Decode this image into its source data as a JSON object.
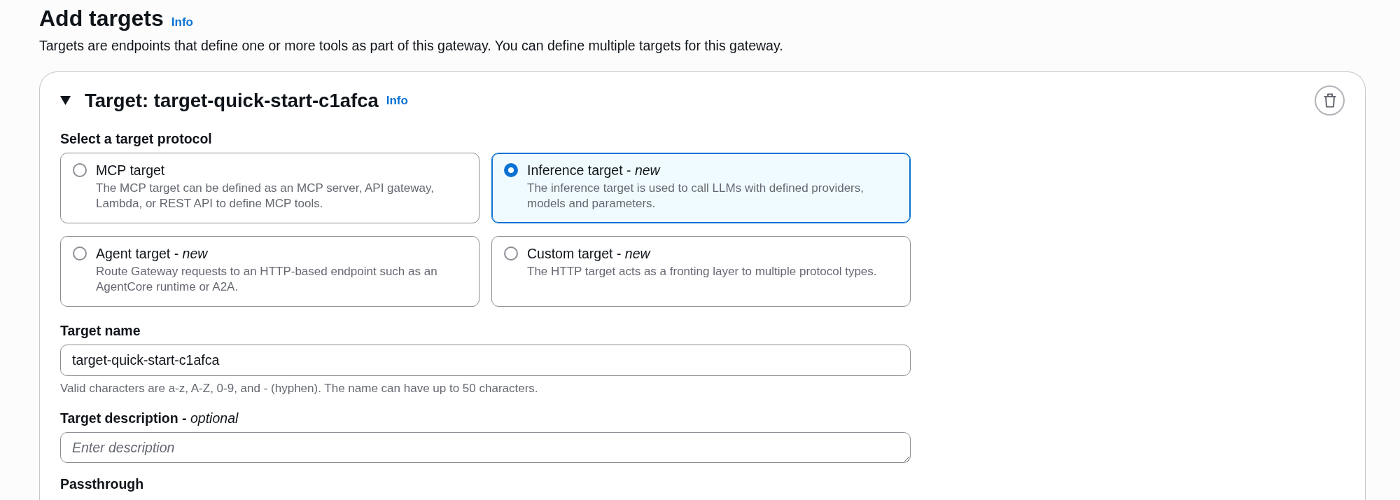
{
  "page": {
    "title": "Add targets",
    "info_link": "Info",
    "description": "Targets are endpoints that define one or more tools as part of this gateway. You can define multiple targets for this gateway."
  },
  "target": {
    "expanded": true,
    "title": "Target: target-quick-start-c1afca",
    "info_link": "Info",
    "protocol": {
      "label": "Select a target protocol",
      "options": [
        {
          "title": "MCP target",
          "description": "The MCP target can be defined as an MCP server, API gateway, Lambda, or REST API to define MCP tools.",
          "selected": false
        },
        {
          "title": "Inference target - *new*",
          "description": "The inference target is used to call LLMs with defined providers, models and parameters.",
          "selected": true
        },
        {
          "title": "Agent target - *new*",
          "description": "Route Gateway requests to an HTTP-based endpoint such as an AgentCore runtime or A2A.",
          "selected": false
        },
        {
          "title": "Custom target - *new*",
          "description": "The HTTP target acts as a fronting layer to multiple protocol types.",
          "selected": false
        }
      ]
    },
    "name_field": {
      "label": "Target name",
      "value": "target-quick-start-c1afca",
      "help": "Valid characters are a-z, A-Z, 0-9, and - (hyphen). The name can have up to 50 characters."
    },
    "description_field": {
      "label": "**Target description** - *optional*",
      "placeholder": "Enter description"
    },
    "passthrough": {
      "label": "Passthrough"
    }
  }
}
